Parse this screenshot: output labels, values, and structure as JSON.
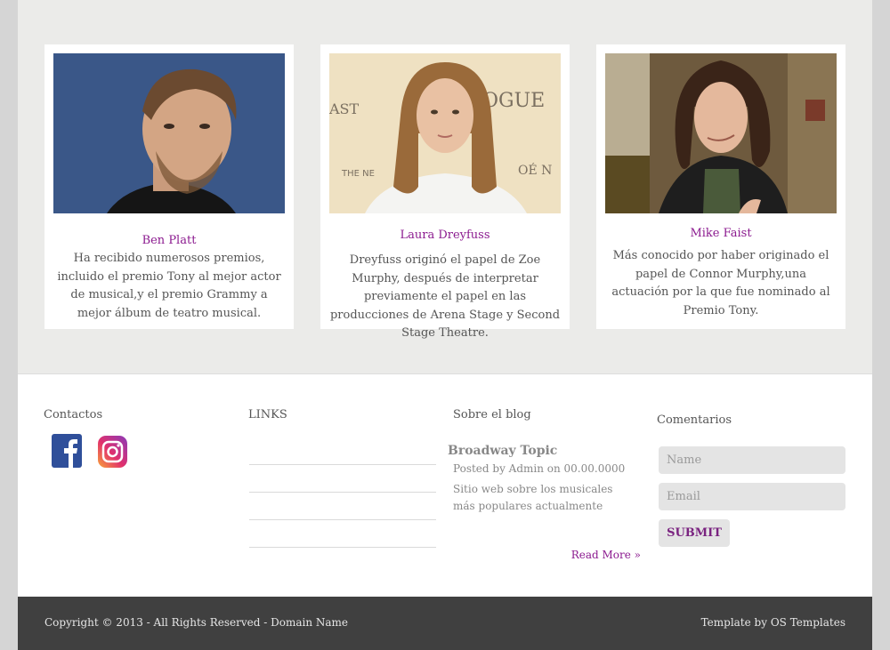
{
  "cards": [
    {
      "name": "Ben Platt",
      "description": "Ha recibido numerosos premios, incluido el premio Tony al mejor actor de musical,y el premio Grammy a mejor álbum de teatro musical."
    },
    {
      "name": "Laura Dreyfuss",
      "description": "Dreyfuss originó el papel de Zoe Murphy, después de interpretar previamente el papel en las producciones de Arena Stage y Second Stage Theatre."
    },
    {
      "name": "Mike Faist",
      "description": "Más conocido por haber originado el papel de Connor Murphy,una actuación por la que fue nominado al Premio Tony."
    }
  ],
  "footer": {
    "contacts_title": "Contactos",
    "links_title": "LINKS",
    "blog_title": "Sobre el blog",
    "comments_title": "Comentarios",
    "social": [
      "facebook-icon",
      "instagram-icon"
    ],
    "blog": {
      "post_title": "Broadway Topic",
      "meta": "Posted by Admin on 00.00.0000",
      "text": "Sitio web sobre los musicales más populares actualmente",
      "read_more": "Read More »"
    },
    "form": {
      "name_placeholder": "Name",
      "email_placeholder": "Email",
      "submit_label": "SUBMIT"
    }
  },
  "bottom": {
    "copyright": "Copyright © 2013 - All Rights Reserved - Domain Name",
    "credit": "Template by OS Templates"
  },
  "colors": {
    "accent": "#8b1a8f",
    "top_bg": "#ebebe9",
    "bottom_bg": "#404040"
  }
}
